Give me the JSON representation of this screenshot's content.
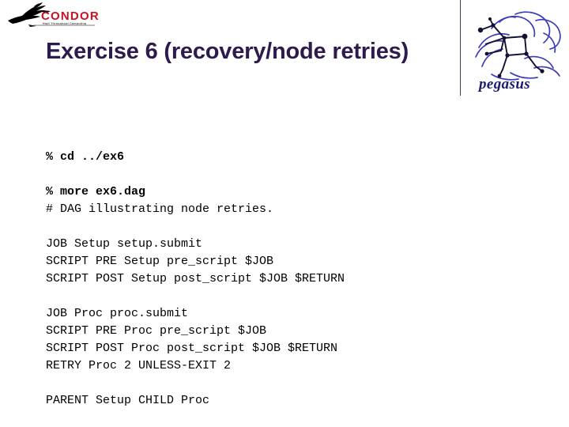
{
  "slide": {
    "title": "Exercise 6 (recovery/node retries)",
    "title_color": "#2d1b4e",
    "background_color": "#ffffff"
  },
  "branding": {
    "condor": {
      "name": "CONDOR",
      "tagline": "High Throughput Computing",
      "text_color": "#cc1122",
      "bird_color": "#000000"
    },
    "pegasus": {
      "name": "pegasus",
      "line_color": "#3b3bbb",
      "text_color": "#1a1a6e"
    }
  },
  "code": {
    "blocks": [
      {
        "lines": [
          {
            "text": "% cd ../ex6",
            "bold": true
          }
        ]
      },
      {
        "lines": [
          {
            "text": "% more ex6.dag",
            "bold": true
          },
          {
            "text": "# DAG illustrating node retries.",
            "bold": false
          }
        ]
      },
      {
        "lines": [
          {
            "text": "JOB Setup setup.submit",
            "bold": false
          },
          {
            "text": "SCRIPT PRE Setup pre_script $JOB",
            "bold": false
          },
          {
            "text": "SCRIPT POST Setup post_script $JOB $RETURN",
            "bold": false
          }
        ]
      },
      {
        "lines": [
          {
            "text": "JOB Proc proc.submit",
            "bold": false
          },
          {
            "text": "SCRIPT PRE Proc pre_script $JOB",
            "bold": false
          },
          {
            "text": "SCRIPT POST Proc post_script $JOB $RETURN",
            "bold": false
          },
          {
            "text": "RETRY Proc 2 UNLESS-EXIT 2",
            "bold": false
          }
        ]
      },
      {
        "lines": [
          {
            "text": "PARENT Setup CHILD Proc",
            "bold": false
          }
        ]
      }
    ]
  }
}
